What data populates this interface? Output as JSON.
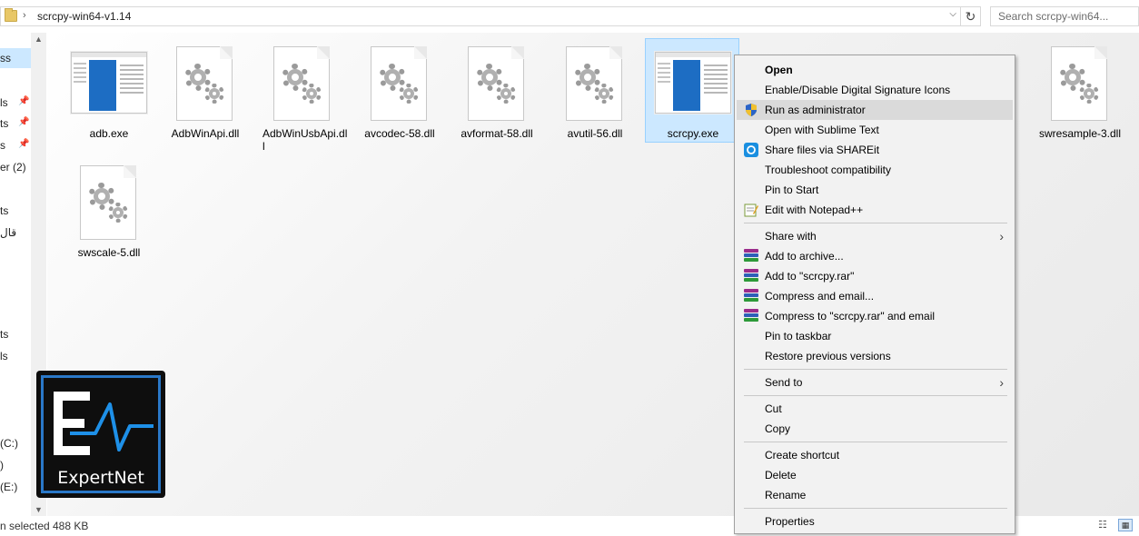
{
  "address_bar": {
    "path": "scrcpy-win64-v1.14",
    "search_placeholder": "Search scrcpy-win64..."
  },
  "nav": {
    "items": [
      {
        "label": "ss",
        "selected": true
      },
      {
        "label": "ls",
        "pinned": true
      },
      {
        "label": "ts",
        "pinned": true
      },
      {
        "label": "s",
        "pinned": true
      },
      {
        "label": "er (2)"
      },
      {
        "label": "ts"
      },
      {
        "label": "قال"
      },
      {
        "label": "ts"
      },
      {
        "label": "ls"
      },
      {
        "label": "(C:)"
      },
      {
        "label": ")"
      },
      {
        "label": "(E:)"
      }
    ]
  },
  "files": [
    {
      "name": "adb.exe",
      "type": "exe"
    },
    {
      "name": "AdbWinApi.dll",
      "type": "dll"
    },
    {
      "name": "AdbWinUsbApi.dll",
      "type": "dll"
    },
    {
      "name": "avcodec-58.dll",
      "type": "dll"
    },
    {
      "name": "avformat-58.dll",
      "type": "dll"
    },
    {
      "name": "avutil-56.dll",
      "type": "dll"
    },
    {
      "name": "scrcpy.exe",
      "type": "exe",
      "selected": true
    },
    {
      "name": "swresample-3.dll",
      "type": "dll"
    },
    {
      "name": "swscale-5.dll",
      "type": "dll"
    }
  ],
  "context_menu": {
    "items": [
      {
        "label": "Open",
        "bold": true
      },
      {
        "label": "Enable/Disable Digital Signature Icons"
      },
      {
        "label": "Run as administrator",
        "icon": "uac-shield-icon",
        "hover": true
      },
      {
        "label": "Open with Sublime Text"
      },
      {
        "label": "Share files via SHAREit",
        "icon": "shareit-icon"
      },
      {
        "label": "Troubleshoot compatibility"
      },
      {
        "label": "Pin to Start"
      },
      {
        "label": "Edit with Notepad++",
        "icon": "notepadpp-icon"
      },
      {
        "label": "Share with",
        "submenu": true
      },
      {
        "label": "Add to archive...",
        "icon": "winrar-icon"
      },
      {
        "label": "Add to \"scrcpy.rar\"",
        "icon": "winrar-icon"
      },
      {
        "label": "Compress and email...",
        "icon": "winrar-icon"
      },
      {
        "label": "Compress to \"scrcpy.rar\" and email",
        "icon": "winrar-icon"
      },
      {
        "label": "Pin to taskbar"
      },
      {
        "label": "Restore previous versions"
      },
      {
        "label": "Send to",
        "submenu": true
      },
      {
        "label": "Cut"
      },
      {
        "label": "Copy"
      },
      {
        "label": "Create shortcut"
      },
      {
        "label": "Delete"
      },
      {
        "label": "Rename"
      },
      {
        "label": "Properties"
      }
    ]
  },
  "status_bar": {
    "selection": "n selected",
    "size": "488 KB"
  },
  "logo": {
    "text": "ExpertNet"
  },
  "colors": {
    "selection_bg": "#cce8ff",
    "selection_border": "#99d1ff",
    "menu_bg": "#f2f2f2",
    "menu_hover": "#dadada",
    "logo_accent": "#2a78c8"
  }
}
